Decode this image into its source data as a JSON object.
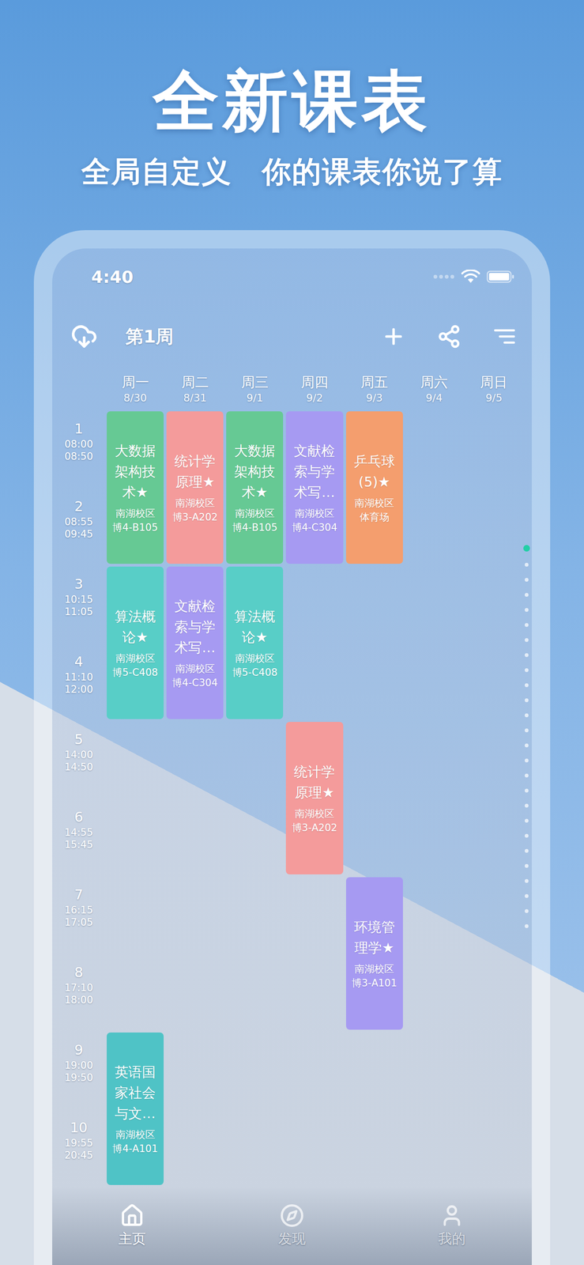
{
  "headline": "全新课表",
  "subtitle": "全局自定义　你的课表你说了算",
  "status_bar": {
    "time": "4:40"
  },
  "toolbar": {
    "week": "第1周"
  },
  "days": [
    {
      "name": "周一",
      "date": "8/30"
    },
    {
      "name": "周二",
      "date": "8/31"
    },
    {
      "name": "周三",
      "date": "9/1"
    },
    {
      "name": "周四",
      "date": "9/2"
    },
    {
      "name": "周五",
      "date": "9/3"
    },
    {
      "name": "周六",
      "date": "9/4"
    },
    {
      "name": "周日",
      "date": "9/5"
    }
  ],
  "periods": [
    {
      "number": "1",
      "start": "08:00",
      "end": "08:50"
    },
    {
      "number": "2",
      "start": "08:55",
      "end": "09:45"
    },
    {
      "number": "3",
      "start": "10:15",
      "end": "11:05"
    },
    {
      "number": "4",
      "start": "11:10",
      "end": "12:00"
    },
    {
      "number": "5",
      "start": "14:00",
      "end": "14:50"
    },
    {
      "number": "6",
      "start": "14:55",
      "end": "15:45"
    },
    {
      "number": "7",
      "start": "16:15",
      "end": "17:05"
    },
    {
      "number": "8",
      "start": "17:10",
      "end": "18:00"
    },
    {
      "number": "9",
      "start": "19:00",
      "end": "19:50"
    },
    {
      "number": "10",
      "start": "19:55",
      "end": "20:45"
    }
  ],
  "courses": [
    {
      "name": "大数据架构技术★",
      "campus": "南湖校区",
      "room": "博4-B105",
      "day": 1,
      "start": 1,
      "span": 2,
      "color": "#66c994"
    },
    {
      "name": "统计学原理★",
      "campus": "南湖校区",
      "room": "博3-A202",
      "day": 2,
      "start": 1,
      "span": 2,
      "color": "#f49b9b"
    },
    {
      "name": "大数据架构技术★",
      "campus": "南湖校区",
      "room": "博4-B105",
      "day": 3,
      "start": 1,
      "span": 2,
      "color": "#66c994"
    },
    {
      "name": "文献检索与学术写…",
      "campus": "南湖校区",
      "room": "博4-C304",
      "day": 4,
      "start": 1,
      "span": 2,
      "color": "#a69af2"
    },
    {
      "name": "乒乓球(5)★",
      "campus": "南湖校区",
      "room": "体育场",
      "day": 5,
      "start": 1,
      "span": 2,
      "color": "#f49e6e"
    },
    {
      "name": "算法概论★",
      "campus": "南湖校区",
      "room": "博5-C408",
      "day": 1,
      "start": 3,
      "span": 2,
      "color": "#58cec7"
    },
    {
      "name": "文献检索与学术写…",
      "campus": "南湖校区",
      "room": "博4-C304",
      "day": 2,
      "start": 3,
      "span": 2,
      "color": "#a69af2"
    },
    {
      "name": "算法概论★",
      "campus": "南湖校区",
      "room": "博5-C408",
      "day": 3,
      "start": 3,
      "span": 2,
      "color": "#58cec7"
    },
    {
      "name": "统计学原理★",
      "campus": "南湖校区",
      "room": "博3-A202",
      "day": 4,
      "start": 5,
      "span": 2,
      "color": "#f49b9b"
    },
    {
      "name": "环境管理学★",
      "campus": "南湖校区",
      "room": "博3-A101",
      "day": 5,
      "start": 7,
      "span": 2,
      "color": "#a69af2"
    },
    {
      "name": "英语国家社会与文…",
      "campus": "南湖校区",
      "room": "博4-A101",
      "day": 1,
      "start": 9,
      "span": 2,
      "color": "#4fc3c6"
    }
  ],
  "week_dots": [
    {
      "selected": true
    },
    {
      "selected": false
    },
    {
      "selected": false
    },
    {
      "selected": false
    },
    {
      "selected": false
    },
    {
      "selected": false
    },
    {
      "selected": false
    },
    {
      "selected": false
    },
    {
      "selected": false
    },
    {
      "selected": false
    },
    {
      "selected": false
    },
    {
      "selected": false
    },
    {
      "selected": false
    },
    {
      "selected": false
    },
    {
      "selected": false
    },
    {
      "selected": false
    },
    {
      "selected": false
    },
    {
      "selected": false
    },
    {
      "selected": false
    },
    {
      "selected": false
    },
    {
      "selected": false
    },
    {
      "selected": false
    },
    {
      "selected": false
    },
    {
      "selected": false
    },
    {
      "selected": false
    },
    {
      "selected": false
    }
  ],
  "tabs": [
    {
      "label": "主页",
      "selected": true
    },
    {
      "label": "发现",
      "selected": false
    },
    {
      "label": "我的",
      "selected": false
    }
  ]
}
